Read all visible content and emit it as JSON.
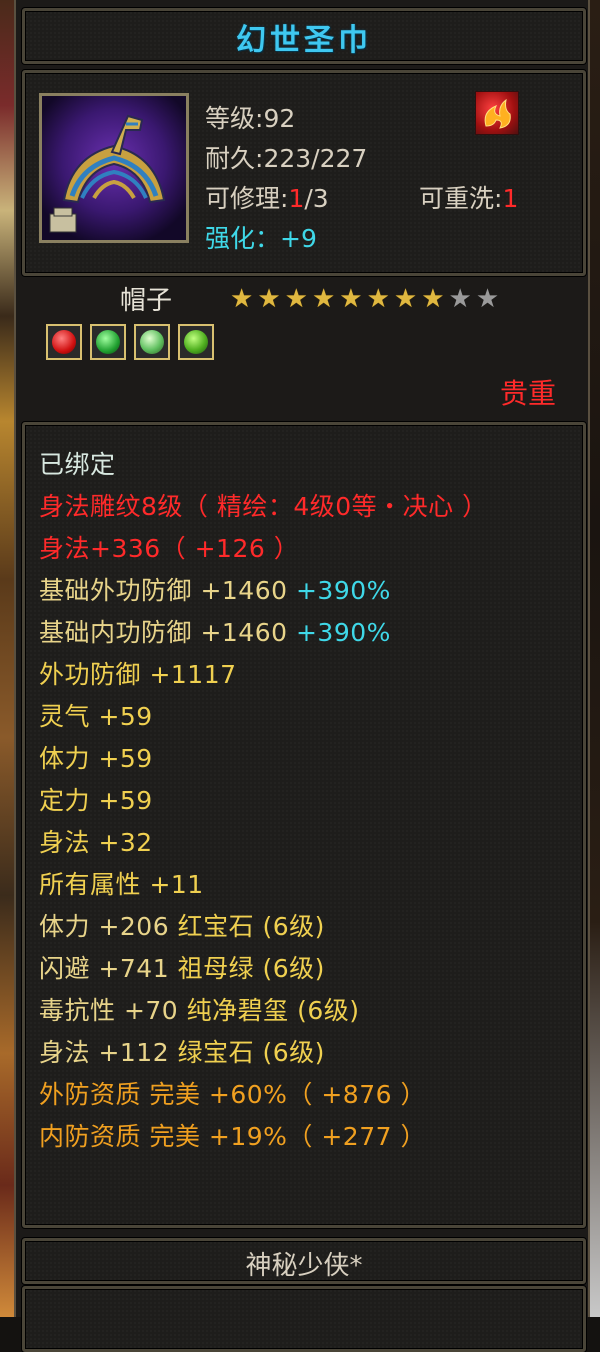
{
  "item": {
    "name": "幻世圣巾",
    "level_label": "等级",
    "level_value": "92",
    "durability_label": "耐久",
    "durability_value": "223/227",
    "repair_label": "可修理",
    "repair_current": "1",
    "repair_max": "/3",
    "rewash_label": "可重洗",
    "rewash_value": "1",
    "enhance_label": "强化",
    "enhance_value": "+9",
    "type": "帽子",
    "stars_on": 7,
    "stars_half": 1,
    "stars_total": 10,
    "rarity": "贵重",
    "gem_icons": [
      "ruby-gem-icon",
      "emerald-gem-icon",
      "jade-gem-icon",
      "green-gem-icon"
    ]
  },
  "properties": [
    {
      "text": "已绑定",
      "color": "white"
    },
    {
      "text": "身法雕纹8级（ 精绘：4级0等・决心 ）",
      "color": "red"
    },
    {
      "text": "身法+336（ +126 ）",
      "color": "red"
    },
    {
      "text": "基础外功防御 +1460",
      "extra": " +390%",
      "color": "gold",
      "extra_color": "cyan"
    },
    {
      "text": "基础内功防御 +1460",
      "extra": " +390%",
      "color": "gold",
      "extra_color": "cyan"
    },
    {
      "text": "外功防御 +1117",
      "color": "yellow"
    },
    {
      "text": "灵气 +59",
      "color": "yellow"
    },
    {
      "text": "体力 +59",
      "color": "yellow"
    },
    {
      "text": "定力 +59",
      "color": "yellow"
    },
    {
      "text": "身法 +32",
      "color": "yellow"
    },
    {
      "text": "所有属性 +11",
      "color": "yellow"
    },
    {
      "text": "体力 +206",
      "extra": " 红宝石 (6级)",
      "color": "gold",
      "extra_color": "yellow"
    },
    {
      "text": "闪避 +741",
      "extra": " 祖母绿 (6级)",
      "color": "gold",
      "extra_color": "yellow"
    },
    {
      "text": "毒抗性 +70",
      "extra": " 纯净碧玺 (6级)",
      "color": "gold",
      "extra_color": "yellow"
    },
    {
      "text": "身法 +112",
      "extra": " 绿宝石 (6级)",
      "color": "gold",
      "extra_color": "yellow"
    },
    {
      "text": "外防资质   完美 +60%（ +876 ）",
      "color": "orange"
    },
    {
      "text": "内防资质   完美 +19%（ +277 ）",
      "color": "orange"
    }
  ],
  "footer": {
    "maker": "神秘少侠*"
  }
}
